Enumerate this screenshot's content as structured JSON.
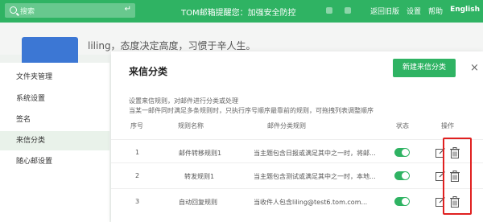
{
  "topbar": {
    "search_placeholder": "搜索",
    "enter_symbol": "↵",
    "brand": "TOM邮箱提醒您：加强安全防控",
    "links": [
      "返回旧版",
      "设置",
      "帮助",
      "English"
    ]
  },
  "profile": {
    "motto": "liling，态度决定高度，习惯于辛人生。"
  },
  "left_menu": {
    "items": [
      {
        "label": "文件夹管理",
        "active": false
      },
      {
        "label": "系统设置",
        "active": false
      },
      {
        "label": "签名",
        "active": false
      },
      {
        "label": "来信分类",
        "active": true
      },
      {
        "label": "随心邮设置",
        "active": false
      }
    ]
  },
  "dialog": {
    "title": "来信分类",
    "new_button": "新建来信分类",
    "close_symbol": "×",
    "desc_line1": "设置来信规则，对邮件进行分类或处理",
    "desc_line2": "当某一邮件同时满足多条规则时，只执行序号顺序最靠前的规则，可拖拽列表调整顺序",
    "columns": {
      "index": "序号",
      "name": "规则名称",
      "rule": "邮件分类规则",
      "status": "状态",
      "actions": "操作"
    },
    "rows": [
      {
        "index": "1",
        "name": "邮件转移规则1",
        "rule": "当主题包含日报或满足其中之一时，将邮...",
        "enabled": true
      },
      {
        "index": "2",
        "name": "转发规则1",
        "rule": "当主题包含测试或满足其中之一时，本地...",
        "enabled": true
      },
      {
        "index": "3",
        "name": "自动回复规则",
        "rule": "当收件人包含liling@test6.tom.com...",
        "enabled": true
      }
    ]
  },
  "colors": {
    "brand_green": "#2fb363",
    "highlight_red": "#e02020",
    "avatar_blue": "#3c77d4"
  }
}
